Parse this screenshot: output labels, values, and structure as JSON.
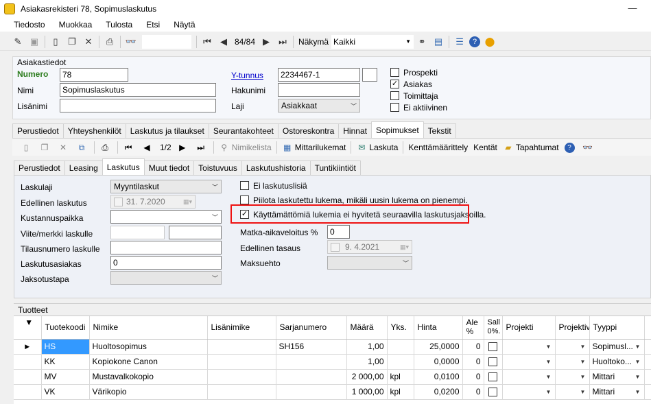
{
  "window": {
    "title": "Asiakasrekisteri 78, Sopimuslaskutus"
  },
  "menu": [
    "Tiedosto",
    "Muokkaa",
    "Tulosta",
    "Etsi",
    "Näytä"
  ],
  "toolbar": {
    "record_pos": "84/84",
    "view_label": "Näkymä",
    "view_value": "Kaikki"
  },
  "customer": {
    "group_title": "Asiakastiedot",
    "numero_label": "Numero",
    "numero_value": "78",
    "nimi_label": "Nimi",
    "nimi_value": "Sopimuslaskutus",
    "lisanimi_label": "Lisänimi",
    "lisanimi_value": "",
    "ytunnus_label": "Y-tunnus",
    "ytunnus_value": "2234467-1",
    "hakunimi_label": "Hakunimi",
    "hakunimi_value": "",
    "laji_label": "Laji",
    "laji_value": "Asiakkaat",
    "checks": [
      {
        "label": "Prospekti",
        "checked": false
      },
      {
        "label": "Asiakas",
        "checked": true
      },
      {
        "label": "Toimittaja",
        "checked": false
      },
      {
        "label": "Ei aktiivinen",
        "checked": false
      }
    ]
  },
  "main_tabs": [
    "Perustiedot",
    "Yhteyshenkilöt",
    "Laskutus ja tilaukset",
    "Seurantakohteet",
    "Ostoreskontra",
    "Hinnat",
    "Sopimukset",
    "Tekstit"
  ],
  "contract_toolbar": {
    "pos": "1/2",
    "nimikelista": "Nimikelista",
    "mittarilukemat": "Mittarilukemat",
    "laskuta": "Laskuta",
    "kenttamaarittely": "Kenttämäärittely",
    "kentat": "Kentät",
    "tapahtumat": "Tapahtumat"
  },
  "sub_tabs": [
    "Perustiedot",
    "Leasing",
    "Laskutus",
    "Muut tiedot",
    "Toistuvuus",
    "Laskutushistoria",
    "Tuntikiintiöt"
  ],
  "billing": {
    "laskulaji_label": "Laskulaji",
    "laskulaji_value": "Myyntilaskut",
    "edellinen_label": "Edellinen laskutus",
    "edellinen_value": "31.  7.2020",
    "kustannus_label": "Kustannuspaikka",
    "kustannus_value": "",
    "viite_label": "Viite/merkki laskulle",
    "tilausnumero_label": "Tilausnumero laskulle",
    "laskutusasiakas_label": "Laskutusasiakas",
    "laskutusasiakas_value": "0",
    "jaksotustapa_label": "Jaksotustapa",
    "check_ei_lisia": "Ei laskutuslisiä",
    "check_piilota": "Piilota laskutettu lukema, mikäli uusin lukema on pienempi.",
    "check_kayttamattomia": "Käyttämättömiä lukemia ei hyvitetä seuraavilla laskutusjaksoilla.",
    "matka_label": "Matka-aikaveloitus %",
    "matka_value": "0",
    "tasaus_label": "Edellinen tasaus",
    "tasaus_value": "9.  4.2021",
    "maksuehto_label": "Maksuehto"
  },
  "products": {
    "group_title": "Tuotteet",
    "columns": [
      "Tuotekoodi",
      "Nimike",
      "Lisänimike",
      "Sarjanumero",
      "Määrä",
      "Yks.",
      "Hinta",
      "Ale %",
      "Sall 0%.",
      "Projekti",
      "Projektiva",
      "Tyyppi"
    ],
    "rows": [
      {
        "code": "HS",
        "name": "Huoltosopimus",
        "extra": "",
        "serial": "SH156",
        "qty": "1,00",
        "unit": "",
        "price": "25,0000",
        "disc": "0",
        "type": "Sopimusl..."
      },
      {
        "code": "KK",
        "name": "Kopiokone Canon",
        "extra": "",
        "serial": "",
        "qty": "1,00",
        "unit": "",
        "price": "0,0000",
        "disc": "0",
        "type": "Huoltoko..."
      },
      {
        "code": "MV",
        "name": "Mustavalkokopio",
        "extra": "",
        "serial": "",
        "qty": "2 000,00",
        "unit": "kpl",
        "price": "0,0100",
        "disc": "0",
        "type": "Mittari"
      },
      {
        "code": "VK",
        "name": "Värikopio",
        "extra": "",
        "serial": "",
        "qty": "1 000,00",
        "unit": "kpl",
        "price": "0,0200",
        "disc": "0",
        "type": "Mittari"
      }
    ]
  }
}
